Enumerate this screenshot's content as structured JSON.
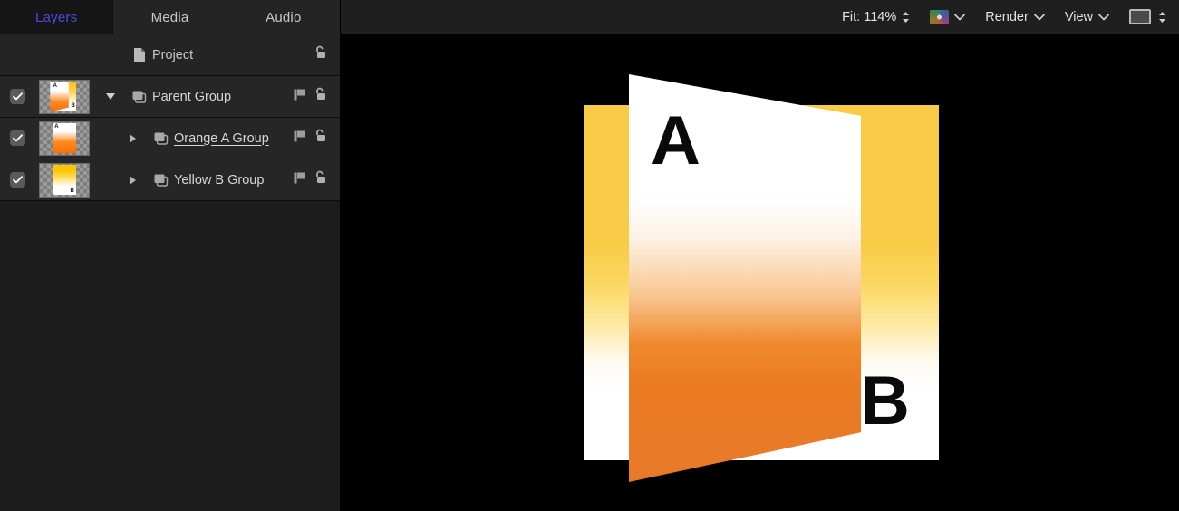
{
  "tabs": [
    {
      "label": "Layers",
      "active": true,
      "name": "tab-layers"
    },
    {
      "label": "Media",
      "active": false,
      "name": "tab-media"
    },
    {
      "label": "Audio",
      "active": false,
      "name": "tab-audio"
    }
  ],
  "layers_list": {
    "project_row": {
      "label": "Project",
      "icon": "document-icon",
      "lock_icon": "unlock-icon"
    },
    "rows": [
      {
        "label": "Parent Group",
        "checked": true,
        "disclosure": "open",
        "indent": 0,
        "kind_icon": "group-icon",
        "thumbnail": "composite-orange-yellow",
        "underlined": false,
        "lock_icon": "unlock-icon",
        "behavior_icon": "behaviors-icon"
      },
      {
        "label": "Orange A Group",
        "checked": true,
        "disclosure": "closed",
        "indent": 1,
        "kind_icon": "group-icon",
        "thumbnail": "orange-gradient",
        "thumb_letter": "A",
        "underlined": true,
        "lock_icon": "unlock-icon",
        "behavior_icon": "behaviors-icon"
      },
      {
        "label": "Yellow B Group",
        "checked": true,
        "disclosure": "closed",
        "indent": 1,
        "kind_icon": "group-icon",
        "thumbnail": "yellow-gradient",
        "thumb_letter": "B",
        "underlined": false,
        "lock_icon": "unlock-icon",
        "behavior_icon": "behaviors-icon"
      }
    ]
  },
  "toolbar": {
    "zoom_label": "Fit: 114%",
    "zoom_stepper_icon": "up-down-stepper-icon",
    "channels_icon": "color-channels-icon",
    "channels_chevron_icon": "chevron-down-icon",
    "render_label": "Render",
    "render_chevron_icon": "chevron-down-icon",
    "view_label": "View",
    "view_chevron_icon": "chevron-down-icon",
    "background_swatch_icon": "background-color-swatch-icon",
    "background_stepper_icon": "up-down-stepper-icon"
  },
  "canvas": {
    "background_color": "#000000",
    "letter_a": "A",
    "letter_b": "B",
    "yellow_layer_color": "#f8ca45",
    "orange_layer_color": "#ee7f26"
  }
}
